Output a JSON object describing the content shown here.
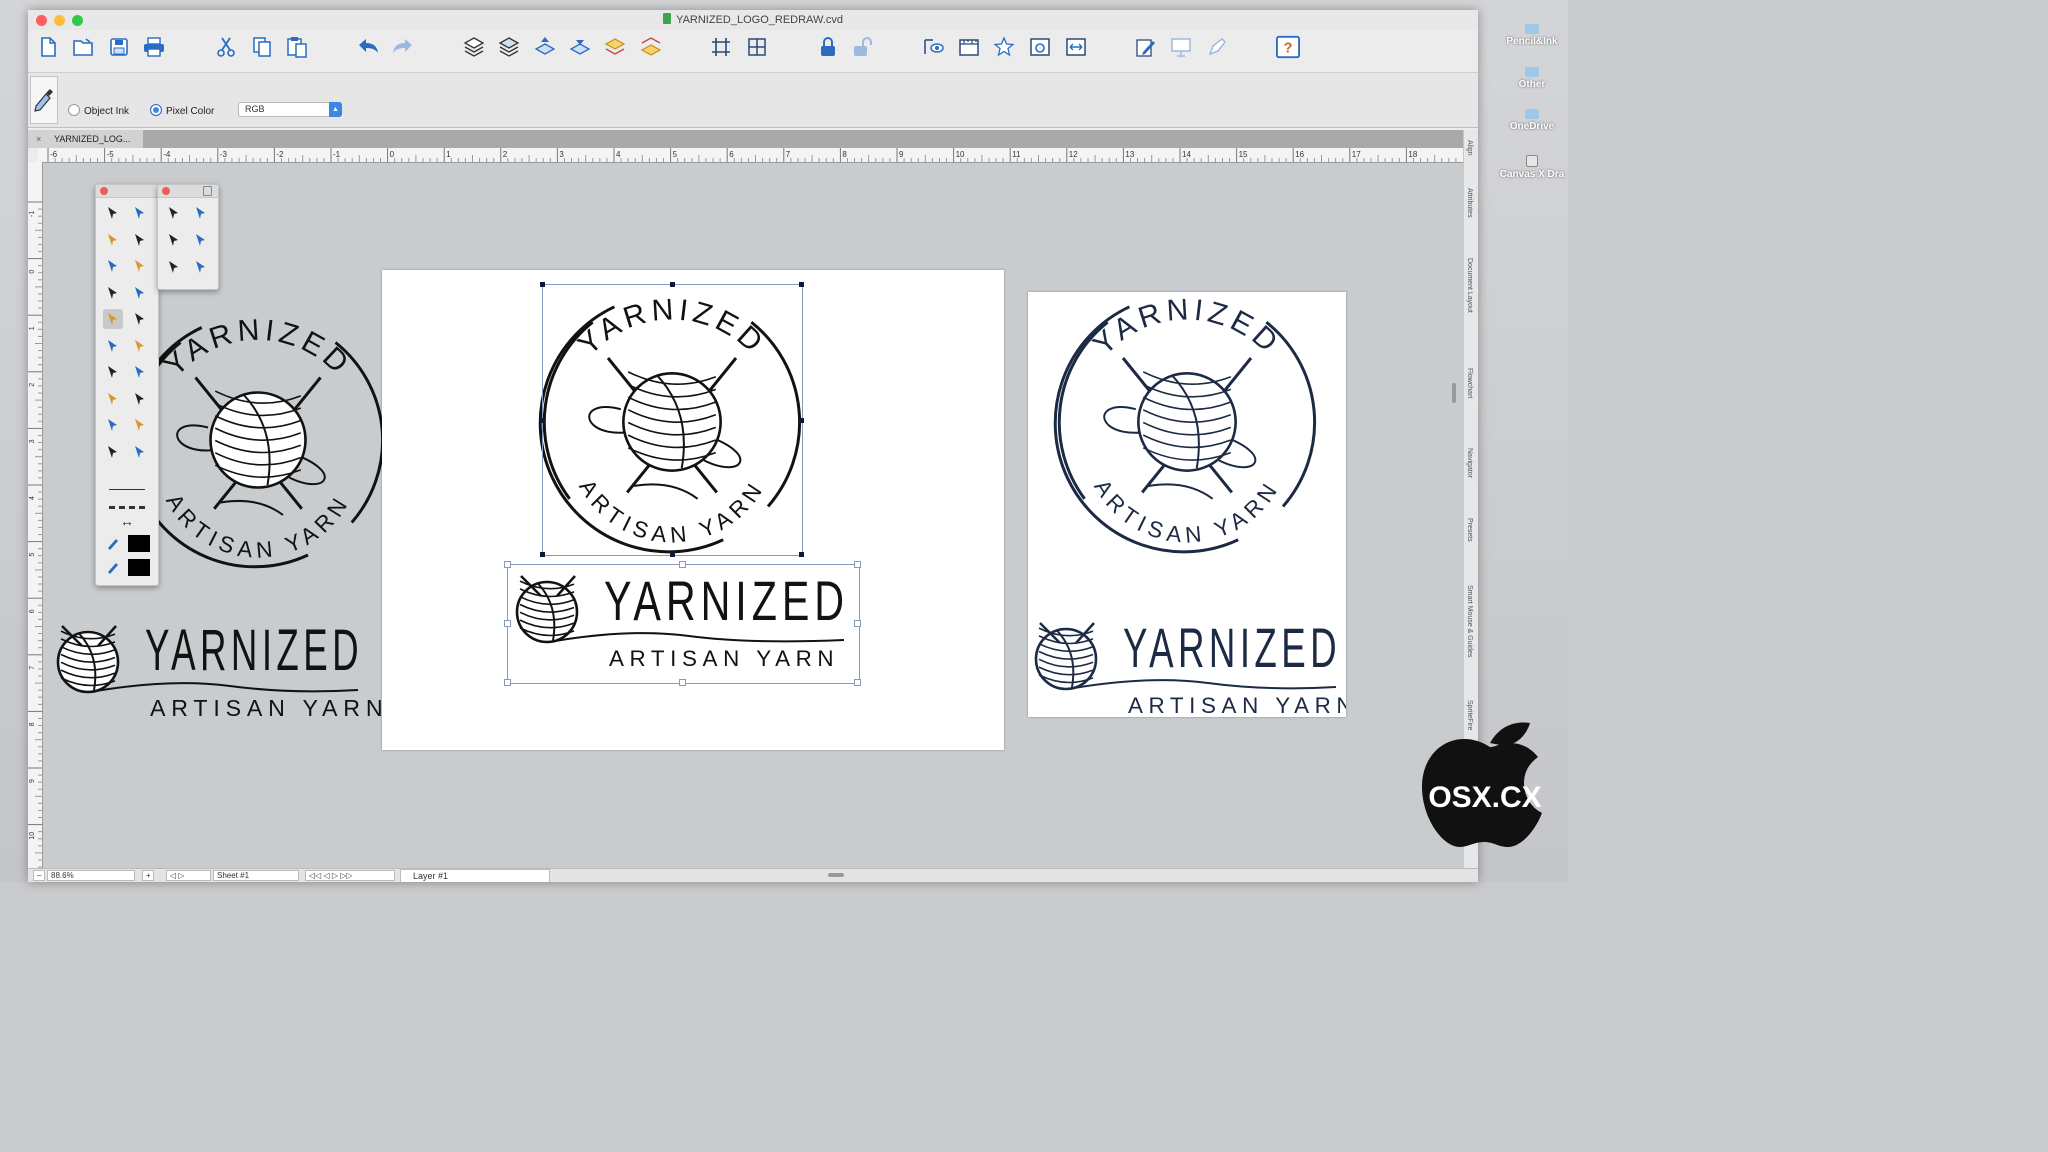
{
  "window": {
    "title": "YARNIZED_LOGO_REDRAW.cvd",
    "traffic_lights": [
      "#fc605c",
      "#fdbc40",
      "#34c84a"
    ]
  },
  "toolbar": {
    "groups": [
      [
        "new-document-icon",
        "open-document-icon",
        "save-icon",
        "print-icon"
      ],
      [
        "cut-icon",
        "copy-icon",
        "paste-icon"
      ],
      [
        "undo-icon",
        "redo-icon"
      ],
      [
        "layers-icon",
        "layers-stack-icon",
        "bring-forward-icon",
        "send-backward-icon",
        "bring-to-front-icon",
        "send-to-back-icon"
      ],
      [
        "grid-icon",
        "guides-grid-icon"
      ],
      [
        "lock-icon",
        "unlock-icon"
      ],
      [
        "view-eye-icon",
        "ruler-icon",
        "star-transform-icon",
        "camera-icon",
        "fit-width-icon"
      ],
      [
        "edit-pencil-icon",
        "presentation-icon",
        "pen-tool-icon"
      ],
      [
        "help-icon"
      ]
    ]
  },
  "properties": {
    "object_ink_label": "Object Ink",
    "pixel_color_label": "Pixel Color",
    "selected_mode": "pixel_color",
    "color_model": "RGB"
  },
  "document_tab": {
    "label": "YARNIZED_LOG..."
  },
  "ruler": {
    "labels": [
      "-6",
      "-5",
      "-4",
      "-3",
      "-2",
      "-1",
      "0",
      "1",
      "2",
      "3",
      "4",
      "5",
      "6",
      "7",
      "8",
      "9",
      "10",
      "11",
      "12",
      "13",
      "14",
      "15",
      "16",
      "17",
      "18"
    ],
    "vertical_labels": [
      "-1",
      "0",
      "1",
      "2",
      "3",
      "4",
      "5",
      "6",
      "7",
      "8",
      "9",
      "10"
    ]
  },
  "side_panels": [
    "Align",
    "Attributes",
    "Document Layout",
    "Flowchart",
    "Navigator",
    "Presets",
    "Smart Mouse & Guides",
    "SpriteFire"
  ],
  "artwork": {
    "logo_word": "YARNIZED",
    "logo_tagline": "ARTISAN YARN"
  },
  "status_bar": {
    "zoom": "88.6%",
    "sheet": "Sheet #1",
    "layer": "Layer #1"
  },
  "dock": {
    "items": [
      "Pencil&Ink",
      "Other",
      "OneDrive",
      "Canvas X Dra"
    ]
  },
  "watermark": {
    "text": "OSX.CX"
  },
  "colors": {
    "accent": "#3b87e6",
    "ink_dark": "#121212",
    "ink_navy": "#1c2a44",
    "canvas_bg": "#c9ccce",
    "swatch_black": "#000000"
  }
}
